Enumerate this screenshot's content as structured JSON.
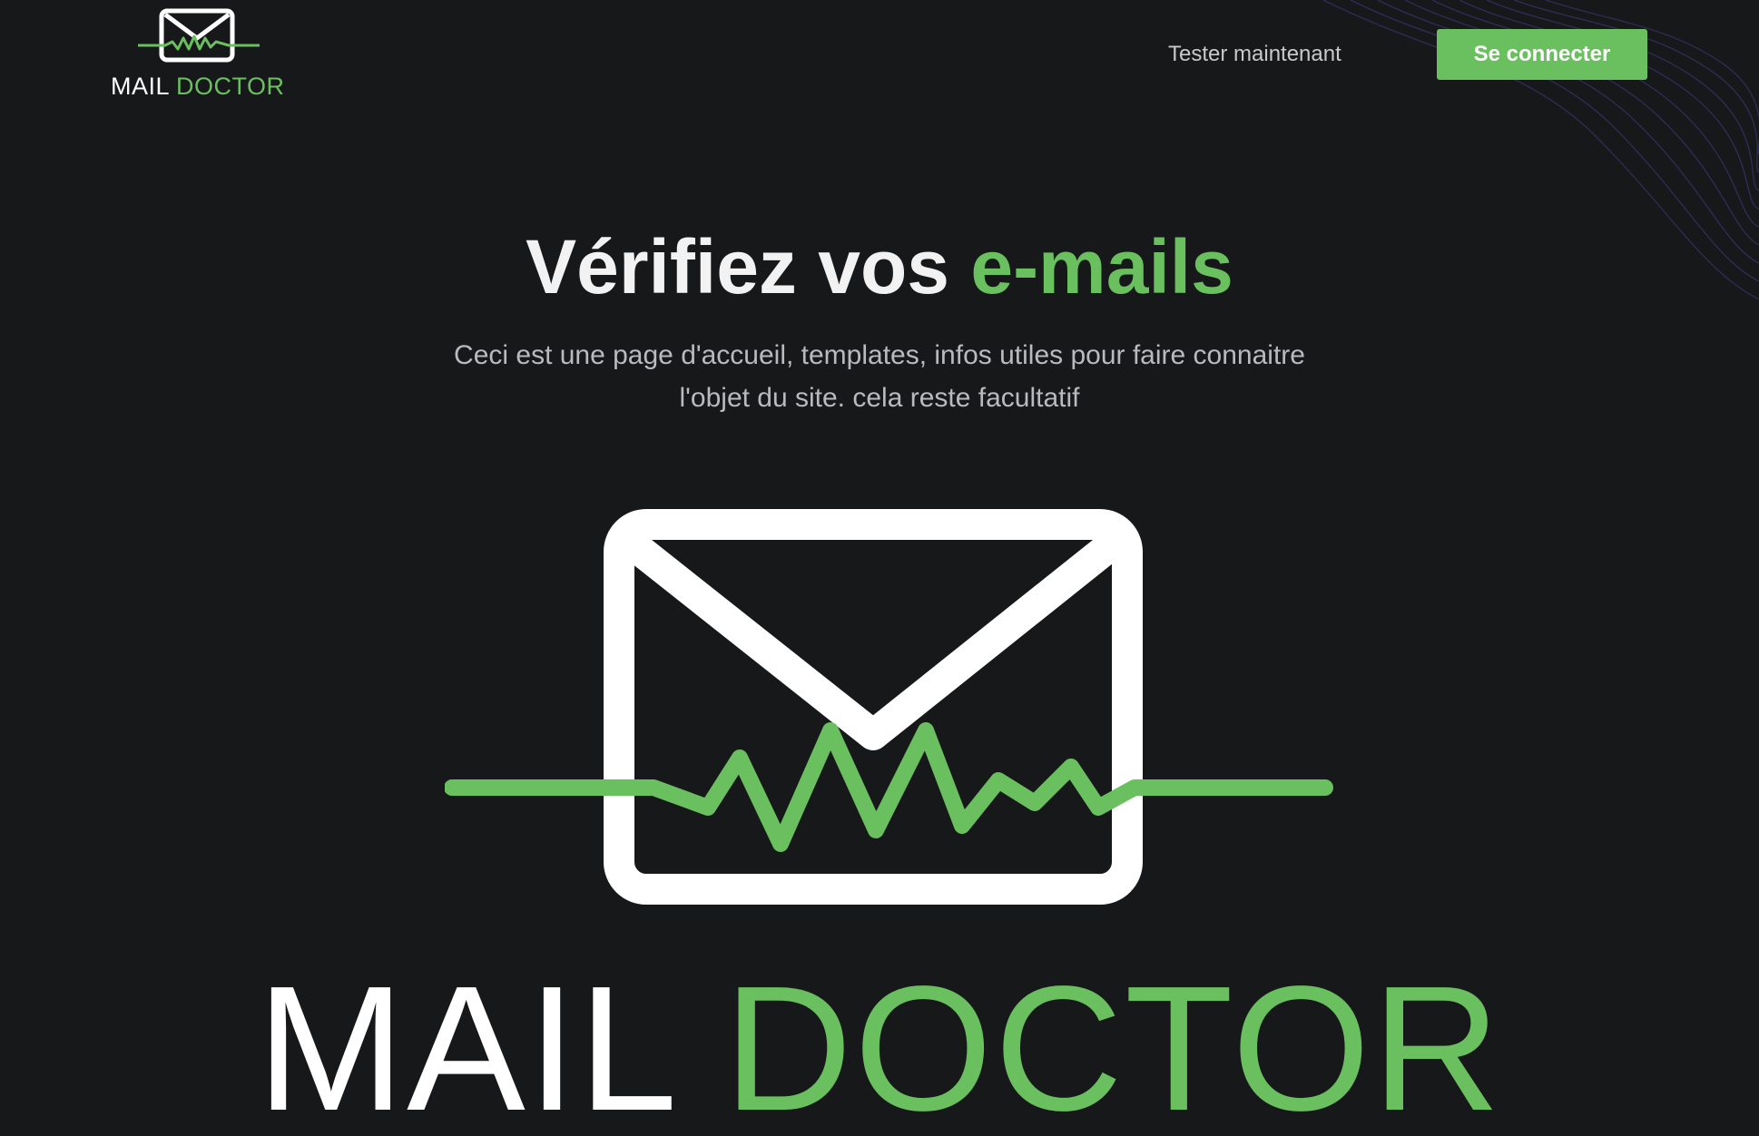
{
  "brand": {
    "name_part1": "MAIL",
    "name_part2": "DOCTOR",
    "logo_icon": "envelope-heartbeat-icon"
  },
  "header": {
    "nav_link_label": "Tester maintenant",
    "login_button_label": "Se connecter"
  },
  "hero": {
    "title_part1": "Vérifiez vos",
    "title_part2": "e-mails",
    "description": "Ceci est une page d'accueil, templates, infos utiles pour faire connaitre l'objet du site. cela reste facultatif"
  },
  "colors": {
    "background": "#17181a",
    "accent_green": "#6abf5e",
    "white": "#ffffff",
    "muted_text": "#b9babd",
    "wave_lines": "#2b2d55"
  }
}
